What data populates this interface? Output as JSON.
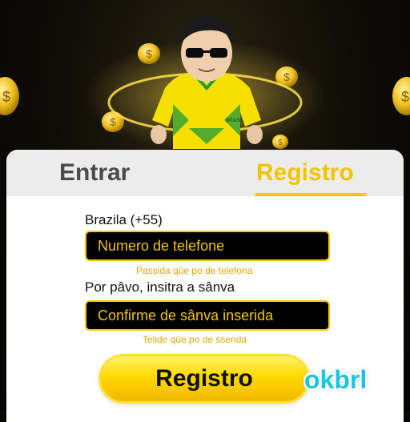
{
  "tabs": {
    "login_label": "Entrar",
    "register_label": "Registro",
    "active": "register"
  },
  "form": {
    "country_label": "Brazila (+55)",
    "phone_placeholder": "Numero de telefone",
    "phone_hint": "Passida qûe po de telefona",
    "password_label": "Por pâvo, insitra a sânva",
    "password_placeholder": "Confirme de sânva inserida",
    "password_hint": "Telide qûe po de sserida",
    "submit_label": "Registro"
  },
  "brand": {
    "name": "okbrl"
  },
  "hero": {
    "jersey_text": "BRASIL"
  },
  "colors": {
    "accent": "#f5c800",
    "field_bg": "#000000",
    "brand": "#19c6e0",
    "jersey": "#f7e000",
    "jersey_green": "#1f9a3a"
  },
  "icons": [
    "gold-coin-icon",
    "player-avatar"
  ]
}
